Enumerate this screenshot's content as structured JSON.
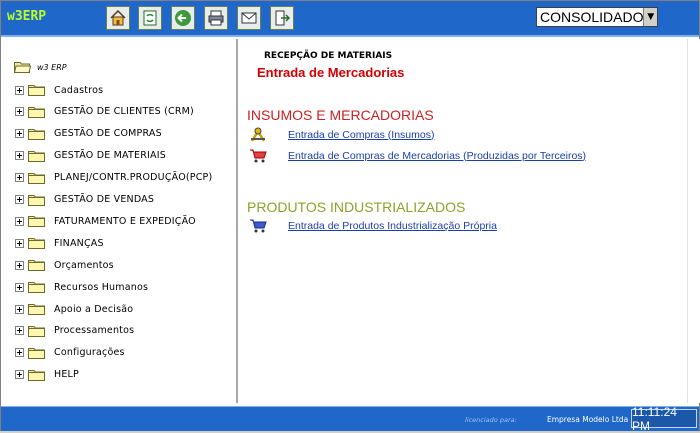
{
  "app": {
    "logo": "w3ERP"
  },
  "toolbar": {
    "buttons": [
      {
        "icon": "home-icon"
      },
      {
        "icon": "refresh-icon"
      },
      {
        "icon": "back-arrow-icon"
      },
      {
        "icon": "print-icon"
      },
      {
        "icon": "mail-icon"
      },
      {
        "icon": "exit-icon"
      }
    ],
    "company_select": {
      "value": "CONSOLIDADO"
    }
  },
  "tree": {
    "root_label": "w3 ERP",
    "items": [
      {
        "label": "Cadastros"
      },
      {
        "label": "GESTÃO DE CLIENTES (CRM)"
      },
      {
        "label": "GESTÃO DE COMPRAS"
      },
      {
        "label": "GESTÃO DE MATERIAIS"
      },
      {
        "label": "PLANEJ/CONTR.PRODUÇÃO(PCP)"
      },
      {
        "label": "GESTÃO DE VENDAS"
      },
      {
        "label": "FATURAMENTO E EXPEDIÇÃO"
      },
      {
        "label": "FINANÇAS"
      },
      {
        "label": "Orçamentos"
      },
      {
        "label": "Recursos Humanos"
      },
      {
        "label": "Apoio a Decisão"
      },
      {
        "label": "Processamentos"
      },
      {
        "label": "Configurações"
      },
      {
        "label": "HELP"
      }
    ]
  },
  "main": {
    "subtitle": "RECEPÇÃO DE MATERIAIS",
    "title": "Entrada de Mercadorias",
    "sections": [
      {
        "heading": "INSUMOS E MERCADORIAS",
        "color": "#cc2222",
        "links": [
          {
            "label": "Entrada de Compras (Insumos)",
            "icon": "tools-icon"
          },
          {
            "label": "Entrada de Compras de Mercadorias (Produzidas por Terceiros)",
            "icon": "cart-icon"
          }
        ]
      },
      {
        "heading": "PRODUTOS INDUSTRIALIZADOS",
        "color": "#8fa12a",
        "links": [
          {
            "label": "Entrada de Produtos Industrialização Própria",
            "icon": "cart-icon"
          }
        ]
      }
    ]
  },
  "footer": {
    "licensed_label": "licenciado para:",
    "company": "Empresa Modelo Ltda",
    "clock": "11:11:24 PM"
  },
  "colors": {
    "bar_blue": "#1f67c9",
    "title_red": "#d40000",
    "link_blue": "#1a3fa8"
  }
}
